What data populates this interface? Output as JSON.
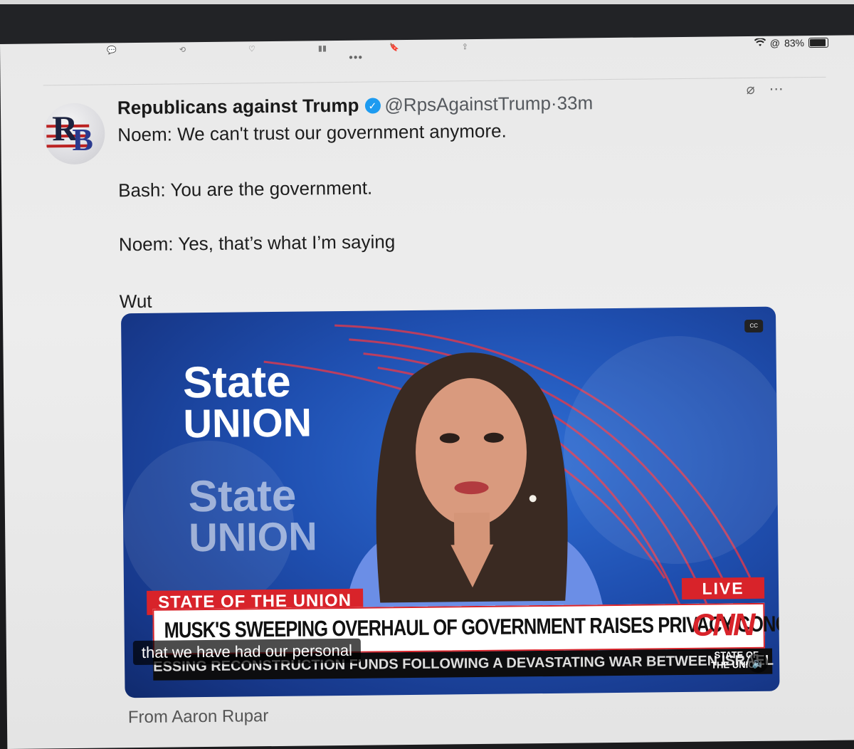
{
  "status_bar": {
    "battery": "83%",
    "wifi_icon": "wifi-icon"
  },
  "post": {
    "author_name": "Republicans against Trump",
    "handle": "@RpsAgainstTrump",
    "separator": "·",
    "time": "33m",
    "avatar_letters": {
      "top": "R",
      "bottom": "B"
    },
    "lines": [
      "Noem: We can't trust our government anymore.",
      "Bash: You are the government.",
      "Noem: Yes, that’s what I’m saying",
      "Wut"
    ]
  },
  "video": {
    "backdrop_title_1": "State",
    "backdrop_title_2": "UNION",
    "show_label": "STATE OF THE UNION",
    "live_label": "LIVE",
    "headline": "MUSK'S SWEEPING OVERHAUL OF GOVERNMENT RAISES PRIVACY CONCERNS",
    "network": "CNN",
    "ticker": "ESSING RECONSTRUCTION FUNDS FOLLOWING A DEVASTATING WAR BETWEEN ISRAEL",
    "ticker_tag": [
      "STATE OF",
      "THE UNION"
    ],
    "caption": "that we have had our personal",
    "cc_label": "CC"
  },
  "footnote": "From Aaron Rupar",
  "colors": {
    "cnn_red": "#d8232a",
    "verified_blue": "#1d9bf0",
    "studio_blue": "#1f4fb0"
  }
}
